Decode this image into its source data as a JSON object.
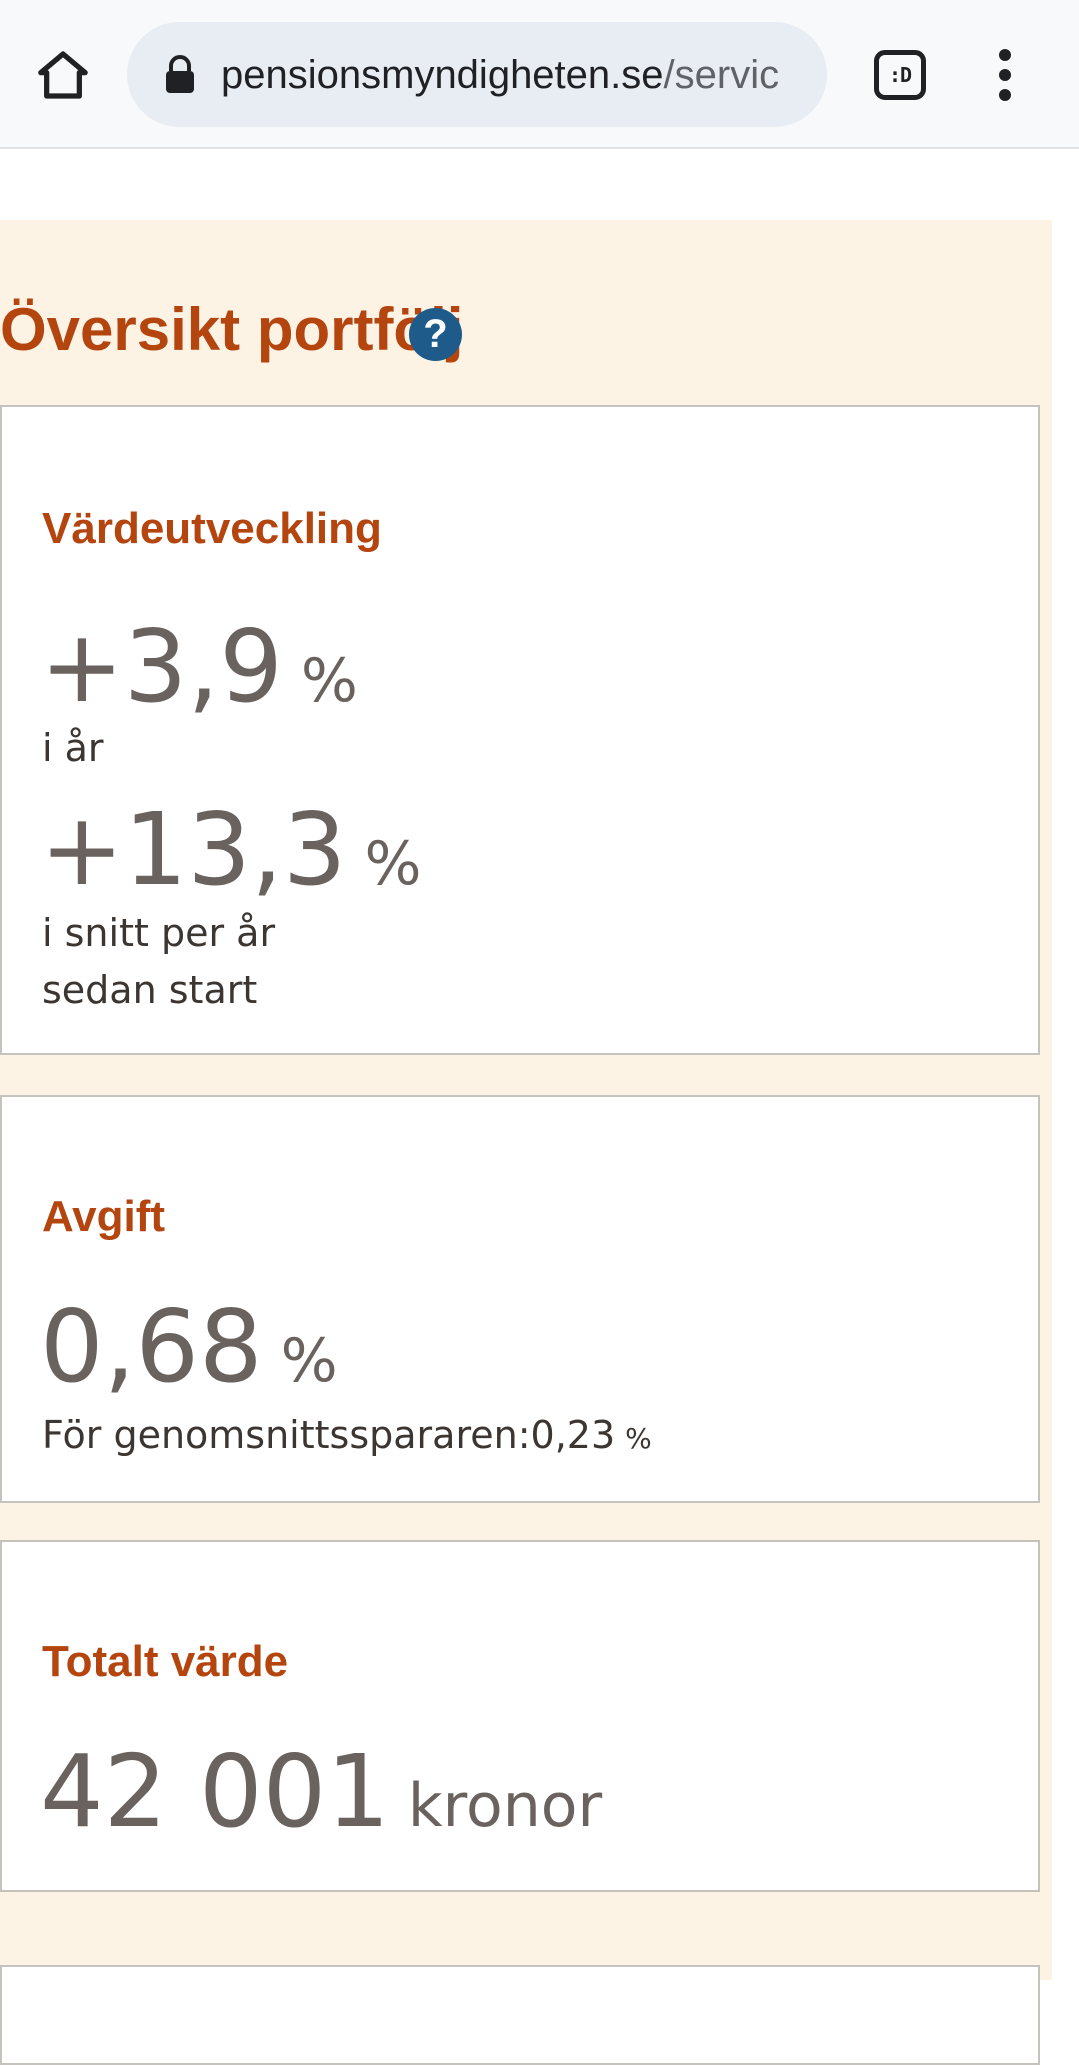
{
  "browser": {
    "url_host": "pensionsmyndigheten.se",
    "url_path": "/servic",
    "tab_switcher_label": ":D",
    "icons": {
      "home": "home-icon",
      "lock": "lock-icon",
      "tabs": "tab-switcher-icon",
      "menu": "more-vert-icon"
    }
  },
  "overview": {
    "title": "Översikt portfölj",
    "help_symbol": "?"
  },
  "value_development": {
    "heading": "Värdeutveckling",
    "this_year_value": "+3,9",
    "this_year_unit": "%",
    "this_year_caption": "i år",
    "avg_value": "+13,3",
    "avg_unit": "%",
    "avg_caption_line1": "i snitt per år",
    "avg_caption_line2": "sedan start"
  },
  "fee": {
    "heading": "Avgift",
    "value": "0,68",
    "unit": "%",
    "average_saver_label": "För genomsnittsspararen:",
    "average_saver_value": "0,23",
    "average_saver_unit": "%"
  },
  "total_value": {
    "heading": "Totalt värde",
    "value": "42 001",
    "unit": "kronor"
  },
  "colors": {
    "accent": "#b4450e",
    "panel_background": "#fdf3e5",
    "value_text": "#6a625e",
    "help_icon": "#1e5a8a"
  }
}
